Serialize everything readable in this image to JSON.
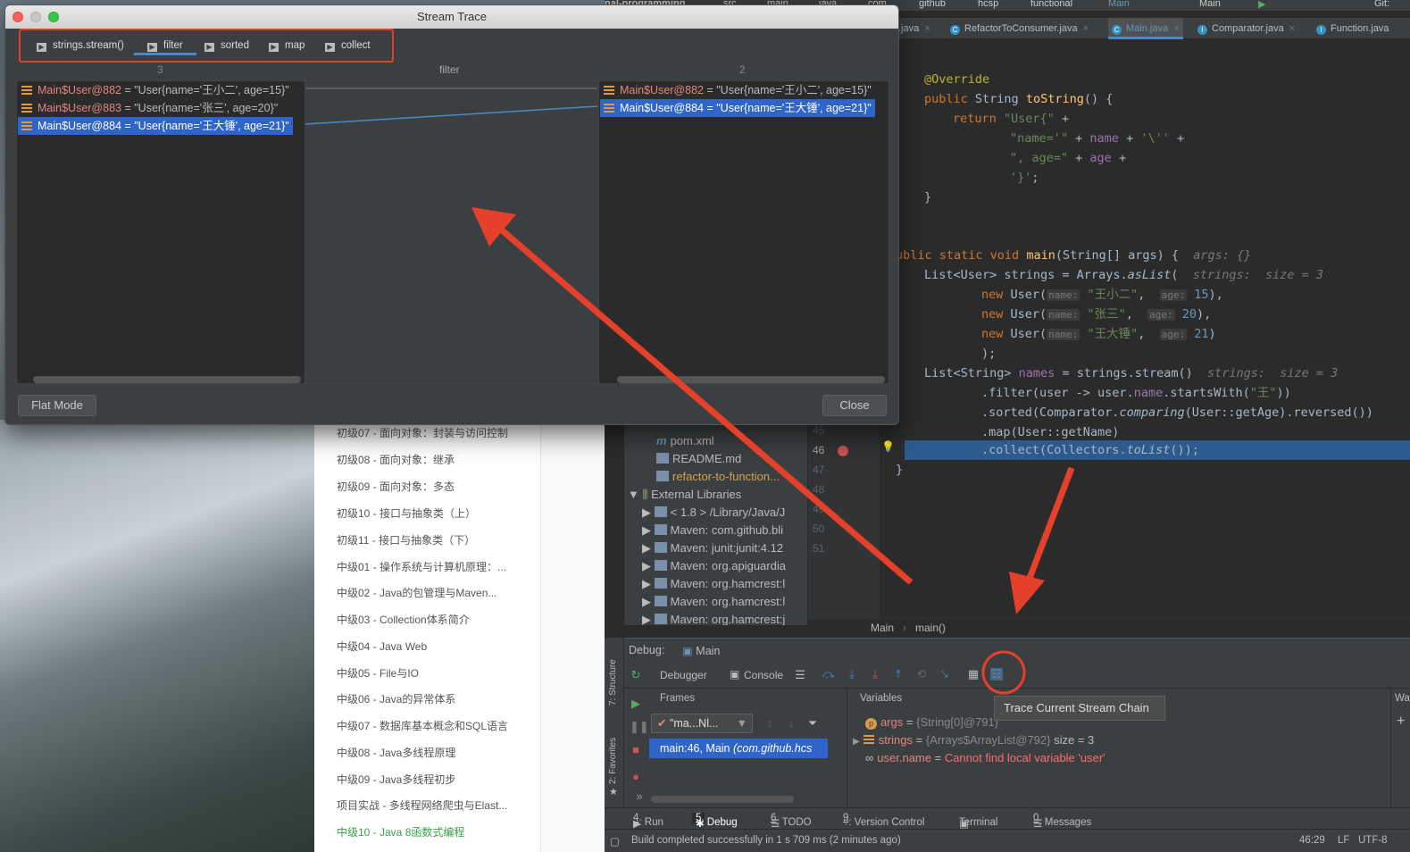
{
  "course_list": {
    "items": [
      "初级07 - 面向对象：封装与访问控制",
      "初级08 - 面向对象：继承",
      "初级09 - 面向对象：多态",
      "初级10 - 接口与抽象类（上）",
      "初级11 - 接口与抽象类（下）",
      "中级01 - 操作系统与计算机原理：...",
      "中级02 - Java的包管理与Maven...",
      "中级03 - Collection体系简介",
      "中级04 - Java Web",
      "中级05 - File与IO",
      "中级06 - Java的异常体系",
      "中级07 - 数据库基本概念和SQL语言",
      "中级08 - Java多线程原理",
      "中级09 - Java多线程初步",
      "项目实战 - 多线程网络爬虫与Elast...",
      "中级10 - Java 8函数式编程"
    ],
    "active_index": 15
  },
  "ide": {
    "nav": {
      "project": "nal-programming",
      "crumbs": [
        "src",
        "main",
        "java",
        "com",
        "github",
        "hcsp",
        "functional"
      ],
      "run_config": "Main",
      "config_select": "Main",
      "git": "Git:"
    },
    "tabs": [
      {
        "label": ".java"
      },
      {
        "label": "RefactorToConsumer.java"
      },
      {
        "label": "Main.java"
      },
      {
        "label": "Comparator.java"
      },
      {
        "label": "Function.java"
      }
    ],
    "project_tree": [
      {
        "label": "pom.xml"
      },
      {
        "label": "README.md"
      },
      {
        "label": "refactor-to-function..."
      },
      {
        "label": "External Libraries"
      },
      {
        "label": "< 1.8 >  /Library/Java/J"
      },
      {
        "label": "Maven: com.github.bli"
      },
      {
        "label": "Maven: junit:junit:4.12"
      },
      {
        "label": "Maven: org.apiguardia"
      },
      {
        "label": "Maven: org.hamcrest:l"
      },
      {
        "label": "Maven: org.hamcrest:l"
      },
      {
        "label": "Maven: org.hamcrest:j"
      }
    ],
    "line_numbers": [
      "45",
      "46",
      "47",
      "48",
      "49",
      "50",
      "51"
    ],
    "code": {
      "override": "@Override",
      "tostring_sig_kw": "public",
      "tostring_sig_type": " String ",
      "tostring_sig_name": "toString",
      "tostring_sig_end": "() {",
      "return_kw": "return",
      "user_str": "\"User{\"",
      "name_str": "\"name='\"",
      "name_fld": "name",
      "quote_str": "'\\''",
      "age_str": "\", age=\"",
      "age_fld": "age",
      "close_str": "'}'",
      "main_kw": "ublic static void",
      "main_name": "main",
      "main_args": "(String[] args) {",
      "main_hint": "args: {}",
      "list_decl": "List<User> strings = Arrays.",
      "aslist": "asList",
      "list_hint": "strings:  size = 3",
      "new_kw": "new",
      "user_cls": " User(",
      "ph_name": "name:",
      "ph_age": "age:",
      "u1_name": "\"王小二\"",
      "u1_age": "15",
      "u2_name": "\"张三\"",
      "u2_age": "20",
      "u3_name": "\"王大锤\"",
      "u3_age": "21",
      "end_list": ");",
      "names_decl": "List<String> ",
      "names_var": "names",
      "names_rest": " = strings.stream()",
      "names_hint": "strings:  size = 3",
      "filter_a": ".filter(user -> user.",
      "filter_fld": "name",
      "filter_b": ".startsWith(",
      "filter_str": "\"王\"",
      "filter_c": "))",
      "sorted_a": ".sorted(Comparator.",
      "sorted_fn": "comparing",
      "sorted_b": "(User::getAge).reversed())",
      "map_line": ".map(User::getName)",
      "collect_a": ".collect(Collectors.",
      "collect_fn": "toList",
      "collect_b": "());"
    },
    "breadcrumb": [
      "Main",
      "main()"
    ],
    "debug": {
      "title": "Debug:",
      "config": "Main",
      "tabs": [
        "Debugger",
        "Console"
      ],
      "frames_label": "Frames",
      "variables_label": "Variables",
      "watches_label": "Wat",
      "thread": "\"ma...Nl...",
      "frame": "main:46, Main",
      "frame_pkg": "(com.github.hcs",
      "variables": [
        {
          "name": "args",
          "eq": " = ",
          "value": "{String[0]@791}",
          "extra": ""
        },
        {
          "name": "strings",
          "eq": " = ",
          "value": "{Arrays$ArrayList@792}",
          "extra": "  size = 3"
        },
        {
          "name": "user.name",
          "eq": " = ",
          "value": "Cannot find local variable 'user'",
          "extra": ""
        }
      ]
    },
    "tooltip": "Trace Current Stream Chain",
    "side_tabs": {
      "structure": "7: Structure",
      "favorites": "2: Favorites"
    },
    "bottom_tabs": [
      {
        "key": "4",
        "label": ": Run"
      },
      {
        "key": "5",
        "label": ": Debug"
      },
      {
        "key": "6",
        "label": ": TODO"
      },
      {
        "key": "9",
        "label": ": Version Control"
      },
      {
        "key": "",
        "label": "Terminal"
      },
      {
        "key": "0",
        "label": ": Messages"
      }
    ],
    "status": {
      "message": "Build completed successfully in 1 s 709 ms (2 minutes ago)",
      "position": "46:29",
      "line_sep": "LF",
      "encoding": "UTF-8"
    }
  },
  "dialog": {
    "title": "Stream Trace",
    "steps": [
      "strings.stream()",
      "filter",
      "sorted",
      "map",
      "collect"
    ],
    "selected_step": 1,
    "left_header": "3",
    "mid_header": "filter",
    "right_header": "2",
    "left_items": [
      {
        "obj": "Main$User@882",
        "text": " = \"User{name='王小二', age=15}\""
      },
      {
        "obj": "Main$User@883",
        "text": " = \"User{name='张三', age=20}\""
      },
      {
        "obj": "Main$User@884",
        "text": " = \"User{name='王大锤', age=21}\""
      }
    ],
    "right_items": [
      {
        "obj": "Main$User@882",
        "text": " = \"User{name='王小二', age=15}\""
      },
      {
        "obj": "Main$User@884",
        "text": " = \"User{name='王大锤', age=21}\""
      }
    ],
    "flat_mode": "Flat Mode",
    "close": "Close"
  },
  "colors": {
    "annotation_red": "#e5402a",
    "selection_blue": "#2f65ca",
    "accent_blue": "#4a88c7"
  }
}
